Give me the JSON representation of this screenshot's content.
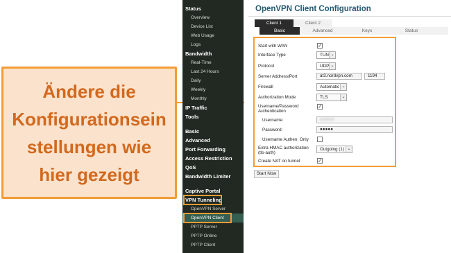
{
  "callout": {
    "text": "Ändere die\nKonfigurationsein\nstellungen wie\nhier gezeigt"
  },
  "sidebar": {
    "items": [
      {
        "label": "Status",
        "kind": "section"
      },
      {
        "label": "Overview",
        "kind": "sub"
      },
      {
        "label": "Device List",
        "kind": "sub"
      },
      {
        "label": "Web Usage",
        "kind": "sub"
      },
      {
        "label": "Logs",
        "kind": "sub"
      },
      {
        "label": "Bandwidth",
        "kind": "section"
      },
      {
        "label": "Real-Time",
        "kind": "sub"
      },
      {
        "label": "Last 24 Hours",
        "kind": "sub"
      },
      {
        "label": "Daily",
        "kind": "sub"
      },
      {
        "label": "Weekly",
        "kind": "sub"
      },
      {
        "label": "Monthly",
        "kind": "sub"
      },
      {
        "label": "IP Traffic",
        "kind": "section"
      },
      {
        "label": "Tools",
        "kind": "section"
      },
      {
        "label": "Basic",
        "kind": "section"
      },
      {
        "label": "Advanced",
        "kind": "section"
      },
      {
        "label": "Port Forwarding",
        "kind": "section"
      },
      {
        "label": "Access Restriction",
        "kind": "section"
      },
      {
        "label": "QoS",
        "kind": "section"
      },
      {
        "label": "Bandwidth Limiter",
        "kind": "section"
      },
      {
        "label": "Captive Portal",
        "kind": "section"
      },
      {
        "label": "VPN Tunneling",
        "kind": "section"
      },
      {
        "label": "OpenVPN Server",
        "kind": "sub"
      },
      {
        "label": "OpenVPN Client",
        "kind": "sub"
      },
      {
        "label": "PPTP Server",
        "kind": "sub"
      },
      {
        "label": "PPTP Online",
        "kind": "sub"
      },
      {
        "label": "PPTP Client",
        "kind": "sub"
      }
    ]
  },
  "main": {
    "title": "OpenVPN Client Configuration",
    "client_tabs": [
      "Client 1",
      "Client 2"
    ],
    "sub_tabs": [
      "Basic",
      "Advanced",
      "Keys",
      "Status"
    ],
    "form": {
      "start_with_wan": {
        "label": "Start with WAN",
        "checked": "✓"
      },
      "interface_type": {
        "label": "Interface Type",
        "value": "TUN"
      },
      "protocol": {
        "label": "Protocol",
        "value": "UDP"
      },
      "server_address": {
        "label": "Server Address/Port",
        "address": "at3.nordvpn.com",
        "port": "1194"
      },
      "firewall": {
        "label": "Firewall",
        "value": "Automatic"
      },
      "authorization_mode": {
        "label": "Authorization Mode",
        "value": "TLS"
      },
      "user_pass_auth": {
        "label": "Username/Password\nAuthentication",
        "checked": "✓"
      },
      "username": {
        "label": "Username:",
        "value": "andrew"
      },
      "password": {
        "label": "Password:",
        "value": "●●●●●"
      },
      "username_authen_only": {
        "label": "Username Authen. Only",
        "checked": ""
      },
      "extra_hmac": {
        "label": "Extra HMAC authorization\n(tls-auth)",
        "value": "Outgoing (1)"
      },
      "create_nat": {
        "label": "Create NAT on tunnel",
        "checked": "✓"
      }
    },
    "start_button": "Start Now"
  },
  "colors": {
    "accent": "#f39c35",
    "callout_bg": "#fbe2cc",
    "callout_text": "#d2691e",
    "sidebar_bg": "#222922",
    "title": "#235a72",
    "highlight": "#335e50"
  },
  "icons": {
    "dropdown": "chevron-down-icon",
    "checkbox": "checkbox-icon",
    "pointer": "arrow-right-icon"
  }
}
